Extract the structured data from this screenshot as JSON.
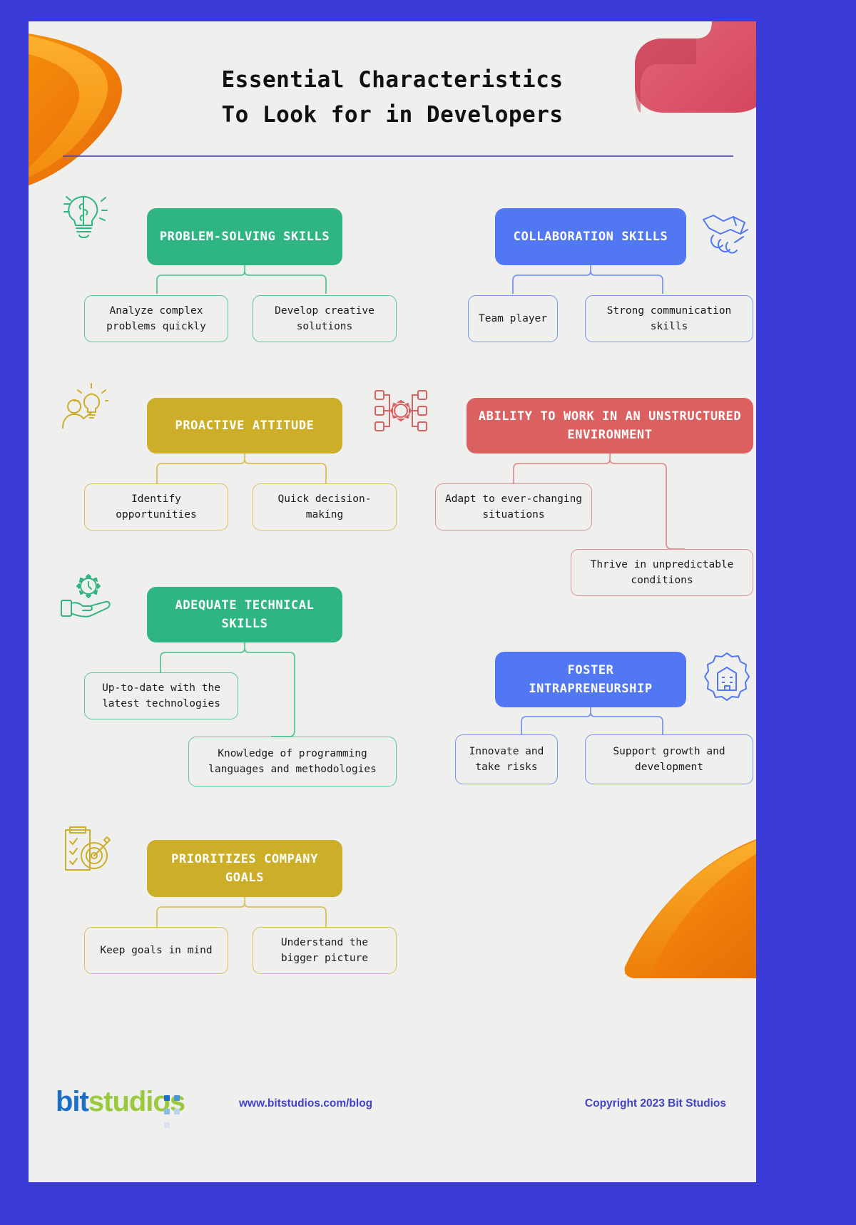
{
  "theme": {
    "page_border_color": "#3B3BD8",
    "canvas_color": "#EFEFEE",
    "title_color": "#111111",
    "green": "#2FB583",
    "blue": "#5277F2",
    "yellow": "#CCAE28",
    "red": "#DB6161",
    "link_color": "#4242C8"
  },
  "header": {
    "title_line1": "Essential Characteristics",
    "title_line2": "To Look for in Developers"
  },
  "sections": [
    {
      "id": "problem-solving",
      "heading": "PROBLEM-SOLVING SKILLS",
      "color": "#2FB583",
      "icon": "lightbulb-brain-icon",
      "leaves": [
        "Analyze complex problems quickly",
        "Develop creative solutions"
      ]
    },
    {
      "id": "collaboration",
      "heading": "COLLABORATION SKILLS",
      "color": "#5277F2",
      "icon": "handshake-icon",
      "leaves": [
        "Team player",
        "Strong communication skills"
      ]
    },
    {
      "id": "proactive-attitude",
      "heading": "PROACTIVE ATTITUDE",
      "color": "#CCAE28",
      "icon": "person-idea-icon",
      "leaves": [
        "Identify opportunities",
        "Quick decision-making"
      ]
    },
    {
      "id": "unstructured-environment",
      "heading": "ABILITY TO WORK IN AN UNSTRUCTURED ENVIRONMENT",
      "color": "#DB6161",
      "icon": "gear-nodes-icon",
      "leaves": [
        "Adapt to ever-changing situations",
        "Thrive in unpredictable conditions"
      ]
    },
    {
      "id": "technical-skills",
      "heading": "ADEQUATE TECHNICAL SKILLS",
      "color": "#2FB583",
      "icon": "hand-gear-icon",
      "leaves": [
        "Up-to-date with the latest technologies",
        "Knowledge of programming languages and methodologies"
      ]
    },
    {
      "id": "foster-intrapreneurship",
      "heading": "FOSTER INTRAPRENEURSHIP",
      "color": "#5277F2",
      "icon": "building-gear-icon",
      "leaves": [
        "Innovate and take risks",
        "Support growth and development"
      ]
    },
    {
      "id": "company-goals",
      "heading": "PRIORITIZES COMPANY GOALS",
      "color": "#CCAE28",
      "icon": "clipboard-target-icon",
      "leaves": [
        "Keep goals in mind",
        "Understand the bigger picture"
      ]
    }
  ],
  "footer": {
    "logo_part1": "bit",
    "logo_part2": "studios",
    "blog_url": "www.bitstudios.com/blog",
    "copyright": "Copyright 2023 Bit Studios"
  }
}
